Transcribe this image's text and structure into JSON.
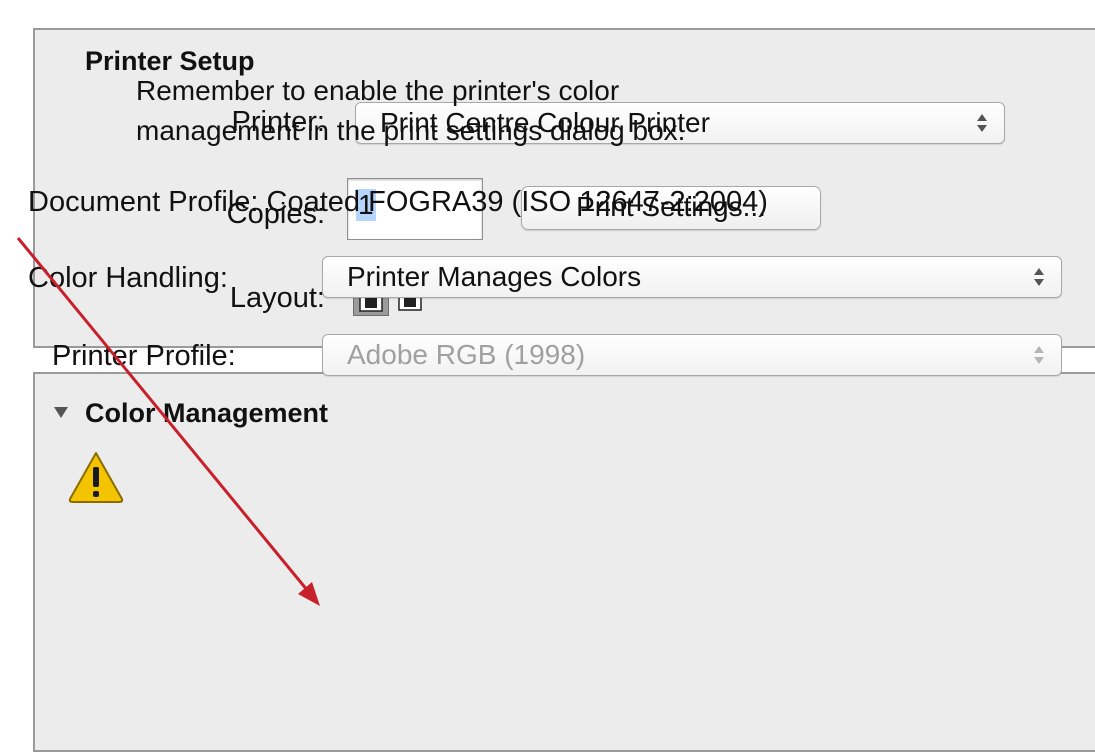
{
  "printer_setup": {
    "title": "Printer Setup",
    "printer_label": "Printer:",
    "printer_value": "Print Centre Colour Printer",
    "copies_label": "Copies:",
    "copies_value": "1",
    "print_settings_button": "Print Settings...",
    "layout_label": "Layout:"
  },
  "color_management": {
    "disclosure_icon": "triangle-down-icon",
    "title": "Color Management",
    "warning_icon": "warning-icon",
    "warning_line1": "Remember to enable the printer's color",
    "warning_line2": "management in the print settings dialog box.",
    "document_profile": "Document Profile: Coated FOGRA39 (ISO 12647-2:2004)",
    "color_handling_label": "Color Handling:",
    "color_handling_value": "Printer Manages Colors",
    "printer_profile_label": "Printer Profile:",
    "printer_profile_value": "Adobe RGB (1998)"
  },
  "colors": {
    "panel_bg": "#ececec",
    "selection": "#b5d5ff",
    "annotation_arrow": "#c8202a",
    "warning_yellow": "#f5c400"
  }
}
